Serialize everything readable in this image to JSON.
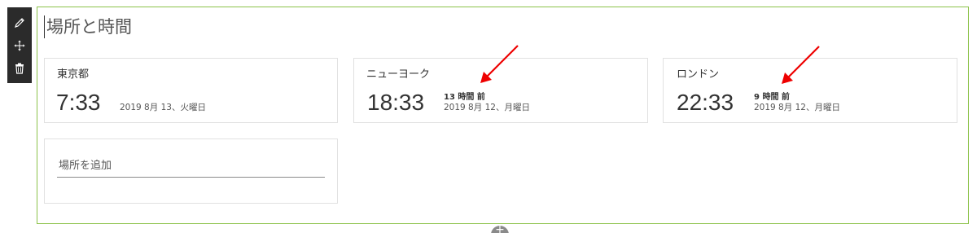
{
  "toolbar": {
    "edit_icon": "pencil-icon",
    "move_icon": "move-icon",
    "delete_icon": "trash-icon"
  },
  "webpart": {
    "title": "場所と時間"
  },
  "locations": [
    {
      "city": "東京都",
      "time": "7:33",
      "offset": "",
      "date": "2019 8月 13、火曜日"
    },
    {
      "city": "ニューヨーク",
      "time": "18:33",
      "offset": "13 時間 前",
      "date": "2019 8月 12、月曜日"
    },
    {
      "city": "ロンドン",
      "time": "22:33",
      "offset": "9 時間 前",
      "date": "2019 8月 12、月曜日"
    }
  ],
  "add_location": {
    "placeholder": "場所を追加"
  },
  "annotations": {
    "arrow_color": "#ee0000"
  },
  "colors": {
    "frame_border": "#8cc24a",
    "toolbar_bg": "#2b2b2b"
  }
}
